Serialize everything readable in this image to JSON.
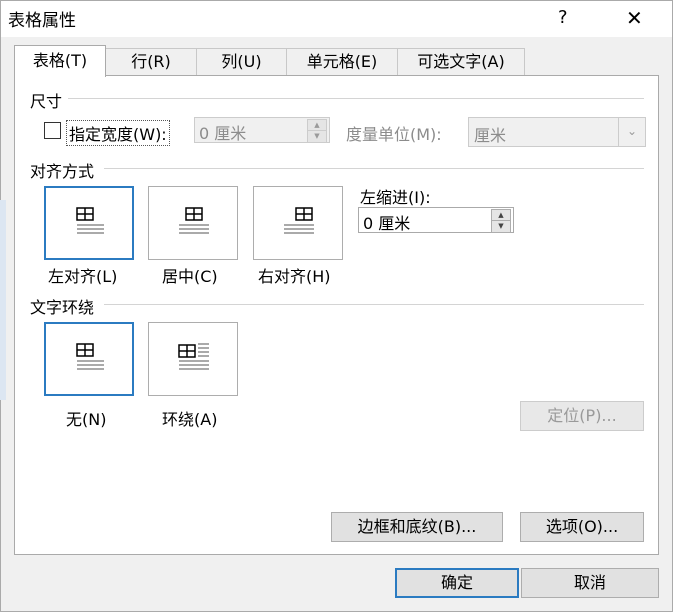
{
  "window": {
    "title": "表格属性",
    "help_label": "?",
    "close_label": "✕"
  },
  "tabs": [
    {
      "label": "表格(T)",
      "active": true
    },
    {
      "label": "行(R)",
      "active": false
    },
    {
      "label": "列(U)",
      "active": false
    },
    {
      "label": "单元格(E)",
      "active": false
    },
    {
      "label": "可选文字(A)",
      "active": false
    }
  ],
  "size": {
    "group_label": "尺寸",
    "specify_width_label": "指定宽度(W):",
    "specify_width_checked": false,
    "width_value": "0 厘米",
    "measure_unit_label": "度量单位(M):",
    "measure_unit_value": "厘米"
  },
  "alignment": {
    "group_label": "对齐方式",
    "options": [
      {
        "label": "左对齐(L)",
        "selected": true,
        "icon": "align-left-icon"
      },
      {
        "label": "居中(C)",
        "selected": false,
        "icon": "align-center-icon"
      },
      {
        "label": "右对齐(H)",
        "selected": false,
        "icon": "align-right-icon"
      }
    ],
    "indent_label": "左缩进(I):",
    "indent_value": "0 厘米"
  },
  "wrapping": {
    "group_label": "文字环绕",
    "options": [
      {
        "label": "无(N)",
        "selected": true,
        "icon": "wrap-none-icon"
      },
      {
        "label": "环绕(A)",
        "selected": false,
        "icon": "wrap-around-icon"
      }
    ],
    "position_button": "定位(P)..."
  },
  "buttons": {
    "borders": "边框和底纹(B)...",
    "options": "选项(O)...",
    "ok": "确定",
    "cancel": "取消"
  },
  "colors": {
    "accent": "#2b7bc1",
    "panel_bg": "#ffffff",
    "dialog_bg": "#f0f0f0"
  }
}
